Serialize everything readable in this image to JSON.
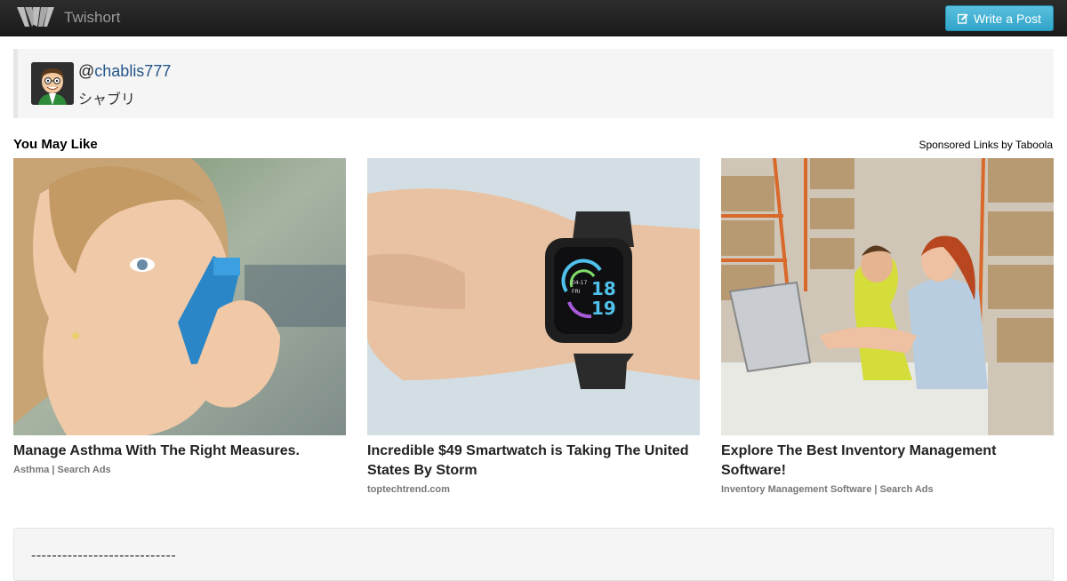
{
  "navbar": {
    "brand_name": "Twishort",
    "write_button_label": "Write a Post"
  },
  "author": {
    "at": "@",
    "username": "chablis777",
    "display_name": "シャブリ"
  },
  "recommendations": {
    "heading": "You May Like",
    "sponsored_label": "Sponsored Links by Taboola",
    "items": [
      {
        "title": "Manage Asthma With The Right Measures.",
        "source": "Asthma | Search Ads"
      },
      {
        "title": "Incredible $49 Smartwatch is Taking The United States By Storm",
        "source": "toptechtrend.com"
      },
      {
        "title": "Explore The Best Inventory Management Software!",
        "source": "Inventory Management Software | Search Ads"
      }
    ]
  },
  "post": {
    "text": "----------------------------"
  },
  "watch_face": {
    "hour": "18",
    "minute": "19"
  },
  "colors": {
    "accent": "#5bc0de",
    "link": "#24568a",
    "navbar": "#1b1b1b"
  }
}
